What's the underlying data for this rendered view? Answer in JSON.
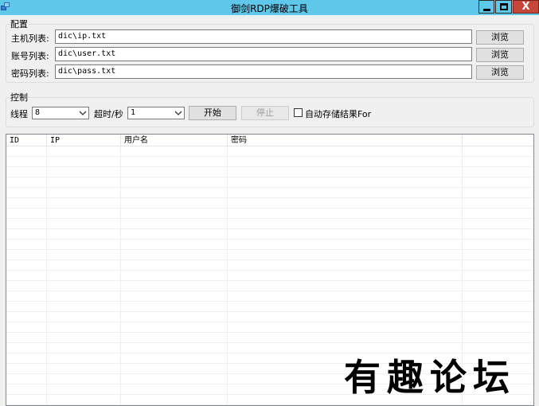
{
  "window": {
    "title": "御剑RDP爆破工具",
    "close_glyph": "X"
  },
  "config": {
    "group_title": "配置",
    "fields": [
      {
        "label": "主机列表:",
        "value": "dic\\ip.txt",
        "browse_label": "浏览"
      },
      {
        "label": "账号列表:",
        "value": "dic\\user.txt",
        "browse_label": "浏览"
      },
      {
        "label": "密码列表:",
        "value": "dic\\pass.txt",
        "browse_label": "浏览"
      }
    ]
  },
  "control": {
    "group_title": "控制",
    "threads_label": "线程",
    "threads_value": "8",
    "timeout_label": "超时/秒",
    "timeout_value": "1",
    "start_label": "开始",
    "stop_label": "停止",
    "autosave_label": "自动存储结果For",
    "autosave_checked": false
  },
  "results": {
    "columns": [
      "ID",
      "IP",
      "用户名",
      "密码"
    ],
    "rows": []
  },
  "watermark": "有趣论坛",
  "colors": {
    "titlebar": "#5fc8ea",
    "close_button": "#c7463a",
    "window_bg": "#f0f0f0"
  }
}
